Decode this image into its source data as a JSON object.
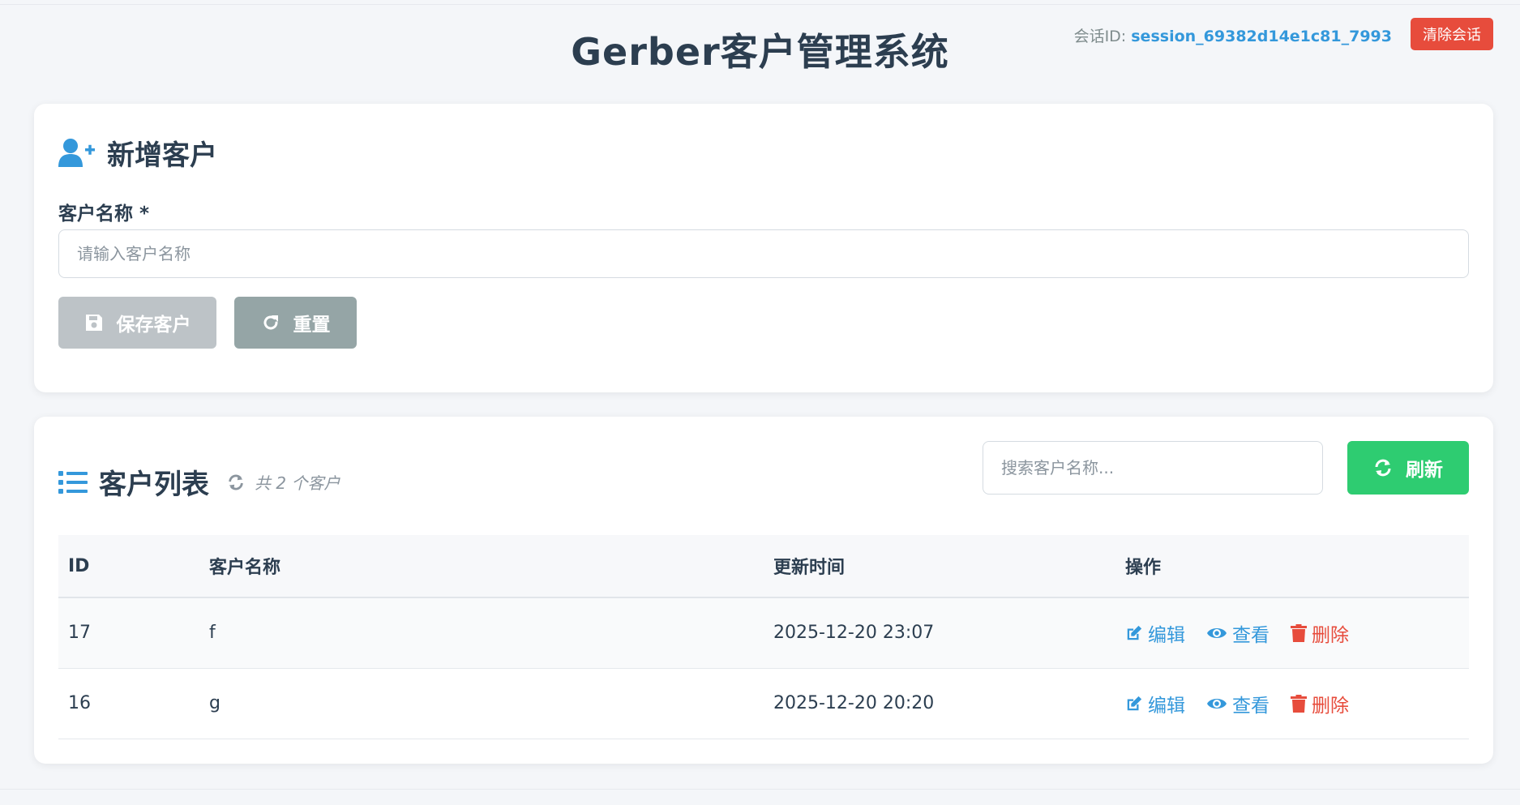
{
  "header": {
    "title": "Gerber客户管理系统",
    "session_label": "会话ID: ",
    "session_id": "session_69382d14e1c81_7993",
    "clear_label": "清除会话"
  },
  "add_section": {
    "title": "新增客户",
    "icon": "user-plus-icon",
    "field_label": "客户名称 *",
    "field_placeholder": "请输入客户名称",
    "field_value": "",
    "save_label": "保存客户",
    "reset_label": "重置"
  },
  "list_section": {
    "title": "客户列表",
    "icon": "list-icon",
    "count_text": "共 2 个客户",
    "search_placeholder": "搜索客户名称...",
    "search_value": "",
    "refresh_label": "刷新",
    "columns": [
      "ID",
      "客户名称",
      "更新时间",
      "操作"
    ],
    "rows": [
      {
        "id": "17",
        "name": "f",
        "updated": "2025-12-20 23:07"
      },
      {
        "id": "16",
        "name": "g",
        "updated": "2025-12-20 20:20"
      }
    ],
    "actions": {
      "edit": "编辑",
      "view": "查看",
      "delete": "删除"
    }
  },
  "colors": {
    "primary": "#3498db",
    "danger": "#e74c3c",
    "success": "#2ecc71",
    "save_disabled": "#bdc3c7",
    "reset": "#95a5a6",
    "text_dark": "#2c3e50"
  }
}
